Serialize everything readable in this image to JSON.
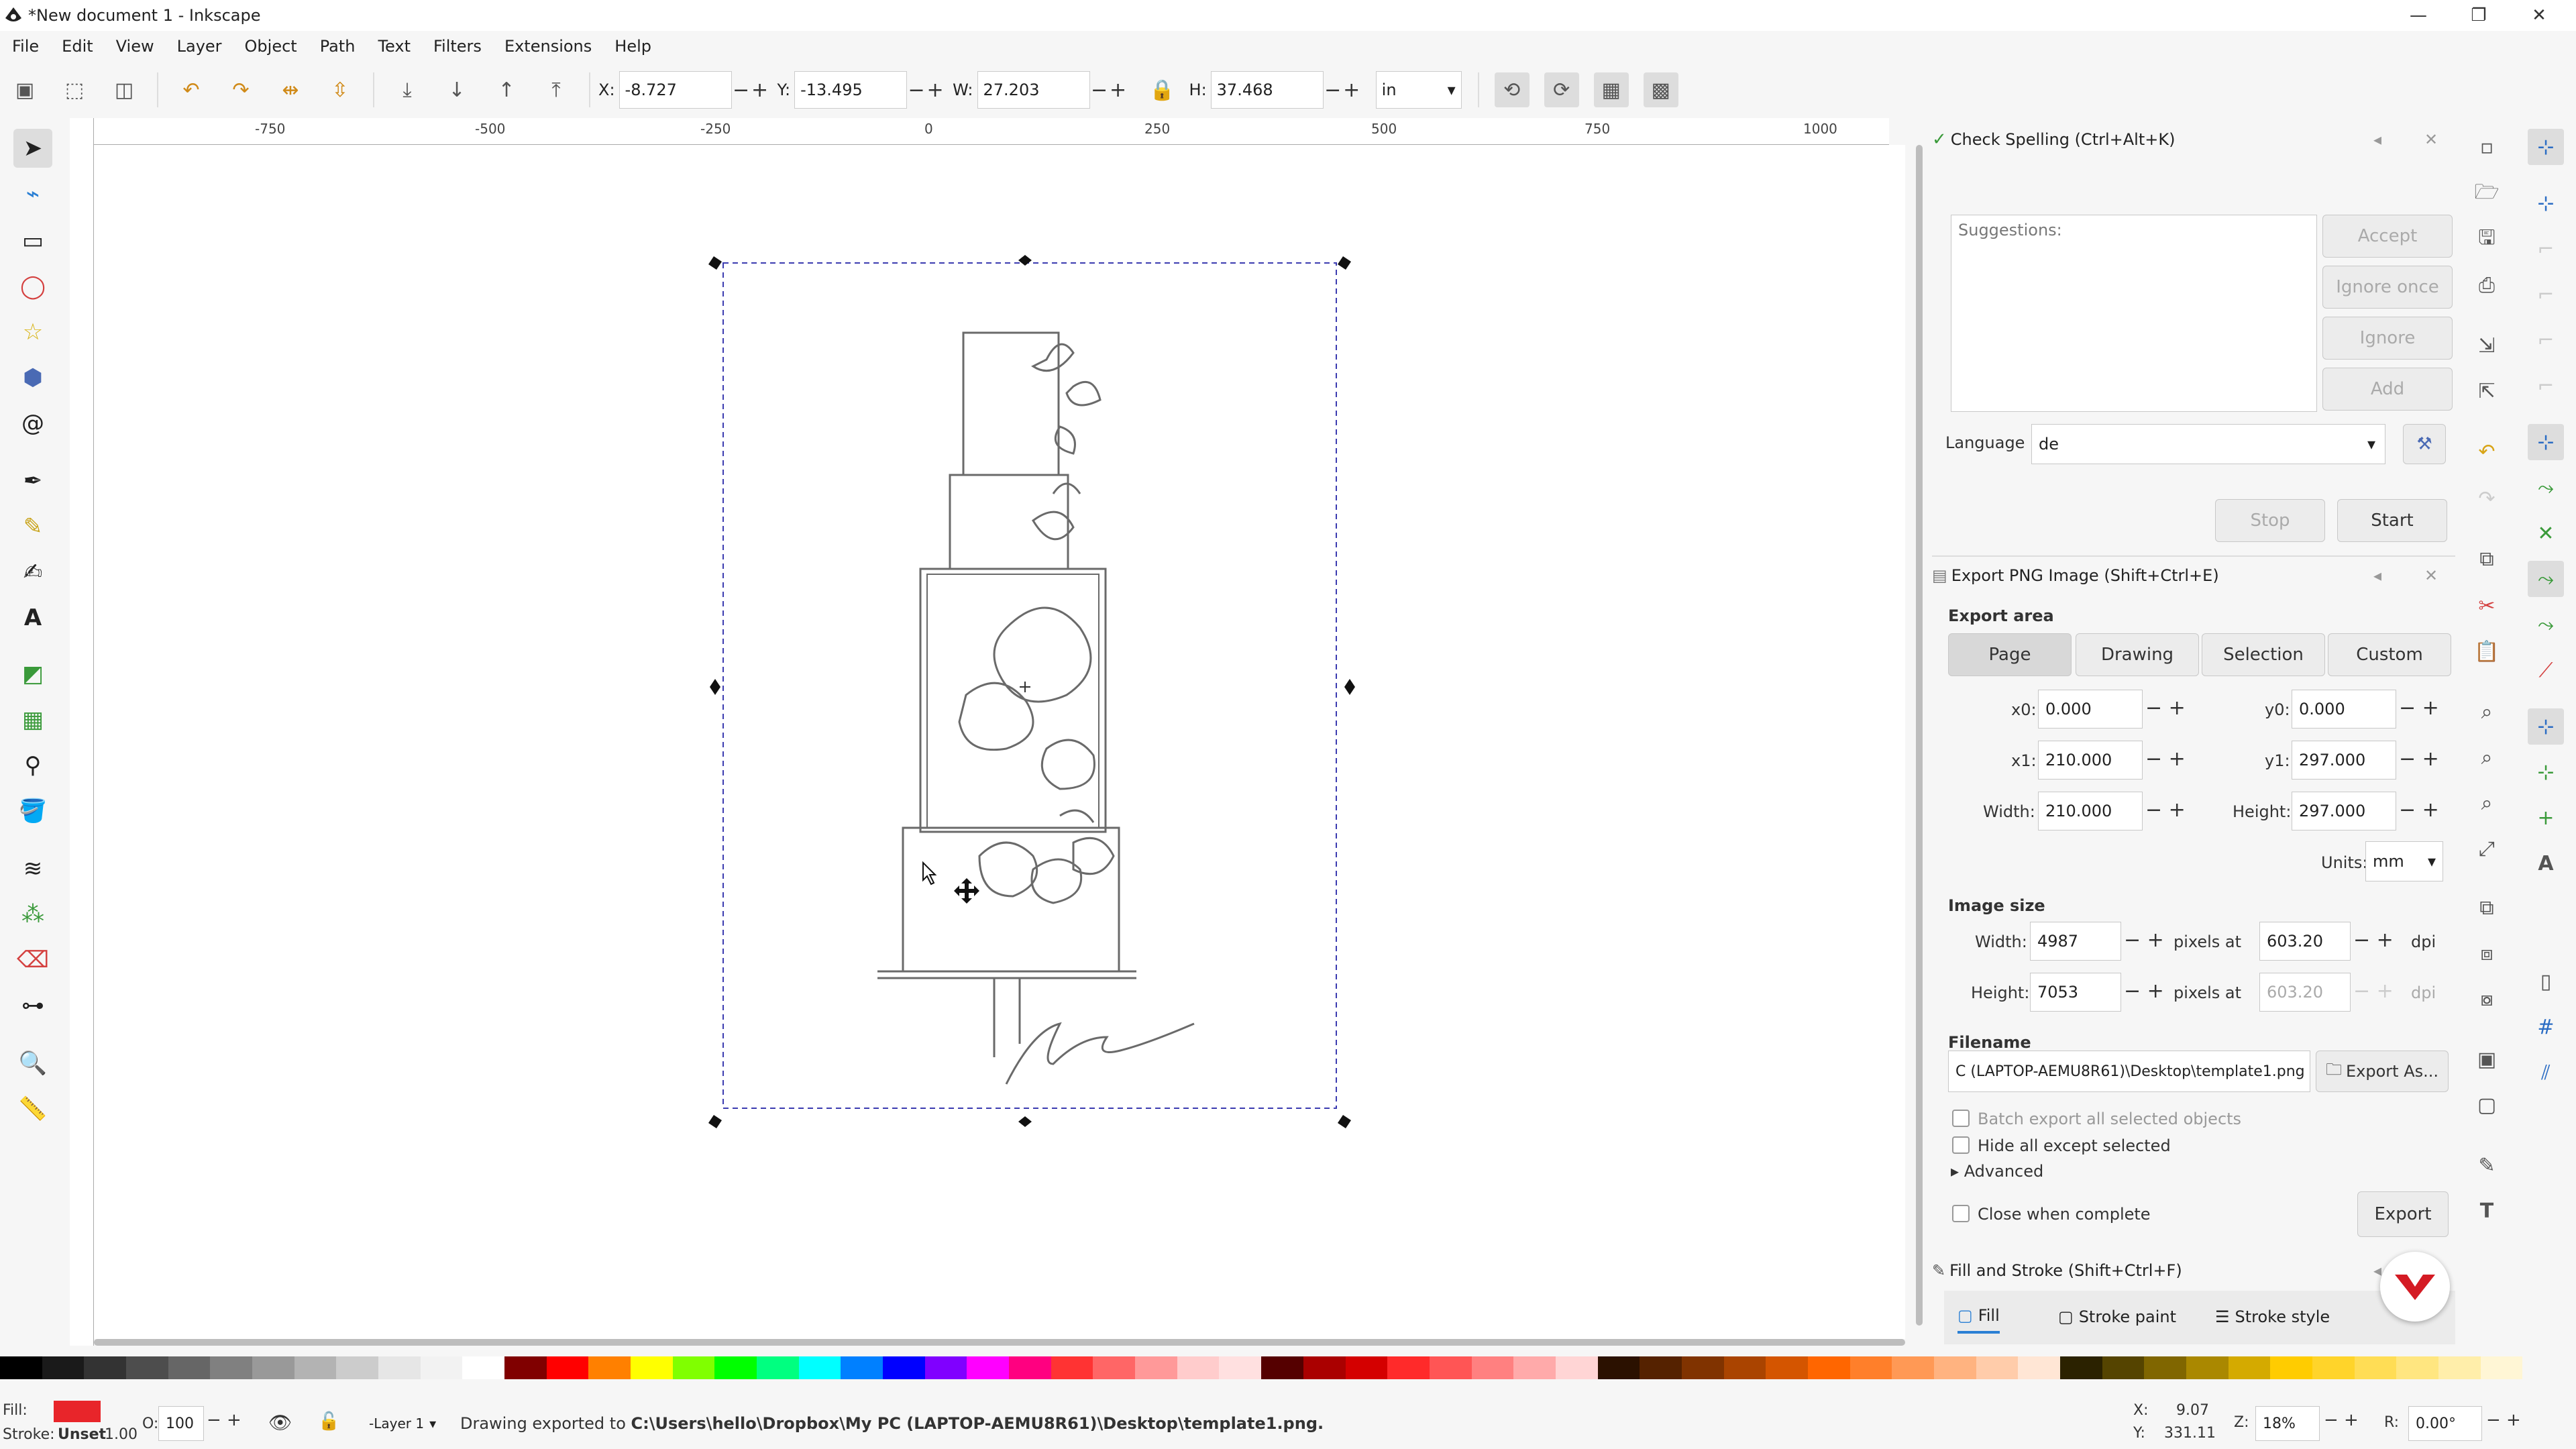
{
  "window": {
    "title": "*New document 1 - Inkscape"
  },
  "menu": [
    "File",
    "Edit",
    "View",
    "Layer",
    "Object",
    "Path",
    "Text",
    "Filters",
    "Extensions",
    "Help"
  ],
  "toolbar": {
    "x_label": "X:",
    "x_value": "-8.727",
    "y_label": "Y:",
    "y_value": "-13.495",
    "w_label": "W:",
    "w_value": "27.203",
    "h_label": "H:",
    "h_value": "37.468",
    "unit": "in"
  },
  "ruler": {
    "ticks": [
      "-750",
      "-500",
      "-250",
      "0",
      "250",
      "500",
      "750",
      "1000"
    ]
  },
  "spell": {
    "title": "Check Spelling (Ctrl+Alt+K)",
    "suggestions_label": "Suggestions:",
    "accept": "Accept",
    "ignore_once": "Ignore once",
    "ignore": "Ignore",
    "add": "Add",
    "language_label": "Language",
    "language_value": "de",
    "stop": "Stop",
    "start": "Start"
  },
  "export": {
    "title": "Export PNG Image (Shift+Ctrl+E)",
    "area_label": "Export area",
    "tabs": [
      "Page",
      "Drawing",
      "Selection",
      "Custom"
    ],
    "x0_label": "x0:",
    "x0": "0.000",
    "y0_label": "y0:",
    "y0": "0.000",
    "x1_label": "x1:",
    "x1": "210.000",
    "y1_label": "y1:",
    "y1": "297.000",
    "width_label": "Width:",
    "width": "210.000",
    "height_label": "Height:",
    "height": "297.000",
    "units_label": "Units:",
    "units": "mm",
    "image_size_label": "Image size",
    "img_width_label": "Width:",
    "img_width": "4987",
    "img_height_label": "Height:",
    "img_height": "7053",
    "pixels_at": "pixels at",
    "dpi1": "603.20",
    "dpi2": "603.20",
    "dpi": "dpi",
    "filename_label": "Filename",
    "filename": "C (LAPTOP-AEMU8R61)\\Desktop\\template1.png",
    "export_as": "Export As...",
    "batch": "Batch export all selected objects",
    "hide": "Hide all except selected",
    "advanced": "Advanced",
    "close_when_complete": "Close when complete",
    "export": "Export"
  },
  "fillstroke": {
    "title": "Fill and Stroke (Shift+Ctrl+F)",
    "tabs": [
      "Fill",
      "Stroke paint",
      "Stroke style"
    ]
  },
  "status": {
    "fill_label": "Fill:",
    "stroke_label": "Stroke:",
    "stroke_value": "Unset",
    "stroke_width": "1.00",
    "opacity_label": "O:",
    "opacity": "100",
    "layer": "-Layer 1",
    "message_prefix": "Drawing exported to ",
    "message_path": "C:\\Users\\hello\\Dropbox\\My PC (LAPTOP-AEMU8R61)\\Desktop\\template1.png.",
    "x_label": "X:",
    "x": "9.07",
    "y_label": "Y:",
    "y": "331.11",
    "zoom_label": "Z:",
    "zoom": "18%",
    "rot_label": "R:",
    "rot": "0.00°"
  },
  "colors": {
    "accent": "#2a7fd4",
    "fill": "#e8252a",
    "snap": "#2a6cc4"
  }
}
